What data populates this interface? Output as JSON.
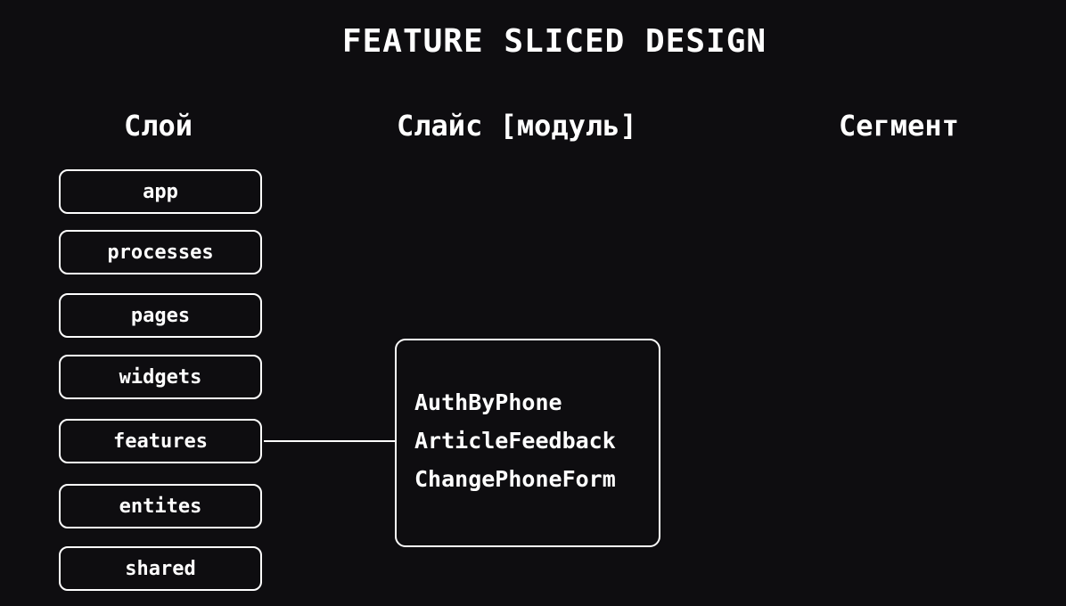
{
  "title": "FEATURE SLICED DESIGN",
  "columns": {
    "layer": "Слой",
    "slice": "Слайс [модуль]",
    "segment": "Сегмент"
  },
  "layers": [
    "app",
    "processes",
    "pages",
    "widgets",
    "features",
    "entites",
    "shared"
  ],
  "slices": [
    "AuthByPhone",
    "ArticleFeedback",
    "ChangePhoneForm"
  ],
  "colors": {
    "background": "#0e0d10",
    "foreground": "#ffffff"
  }
}
